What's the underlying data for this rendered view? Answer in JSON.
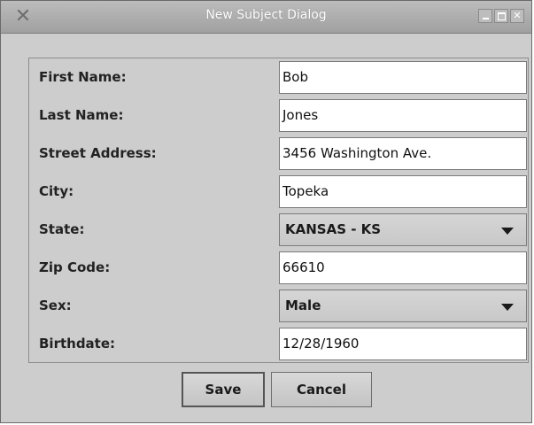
{
  "window": {
    "title": "New Subject Dialog",
    "icon": "x-icon"
  },
  "form": {
    "first_name": {
      "label": "First Name:",
      "value": "Bob"
    },
    "last_name": {
      "label": "Last Name:",
      "value": "Jones"
    },
    "street_address": {
      "label": "Street Address:",
      "value": "3456 Washington Ave."
    },
    "city": {
      "label": "City:",
      "value": "Topeka"
    },
    "state": {
      "label": "State:",
      "value": "KANSAS - KS"
    },
    "zip_code": {
      "label": "Zip Code:",
      "value": "66610"
    },
    "sex": {
      "label": "Sex:",
      "value": "Male"
    },
    "birthdate": {
      "label": "Birthdate:",
      "value": "12/28/1960"
    }
  },
  "buttons": {
    "save": "Save",
    "cancel": "Cancel"
  }
}
